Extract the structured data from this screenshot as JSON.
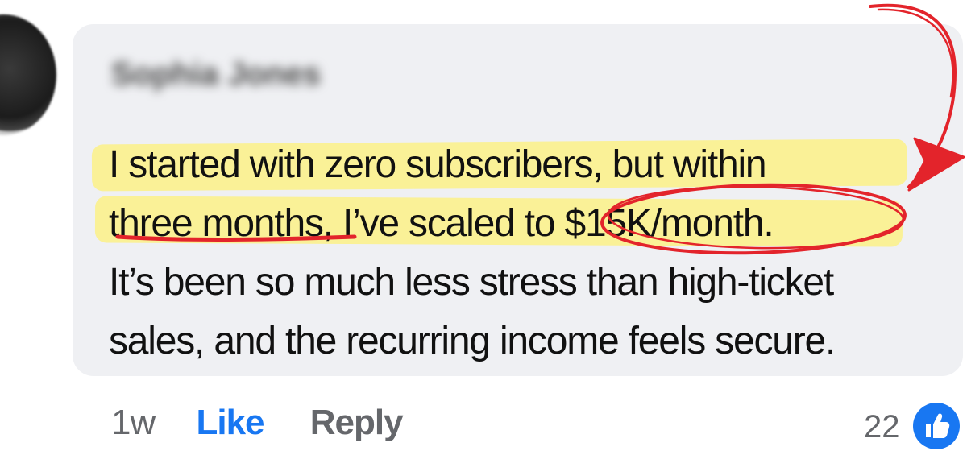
{
  "comment": {
    "author_name": "Sophia Jones",
    "lines": [
      "I started with zero subscribers, but within",
      "three months, I’ve scaled to $15K/month.",
      "It’s been so much less stress than high-ticket",
      "sales, and the recurring income feels secure."
    ]
  },
  "actions": {
    "time": "1w",
    "like": "Like",
    "reply": "Reply"
  },
  "reactions": {
    "count": "22",
    "icon": "thumbs-up-icon"
  },
  "colors": {
    "bubble": "#eff0f3",
    "highlight": "#fbf18d",
    "annotation": "#e3242b",
    "like_blue": "#1877f2",
    "muted": "#65676b"
  }
}
